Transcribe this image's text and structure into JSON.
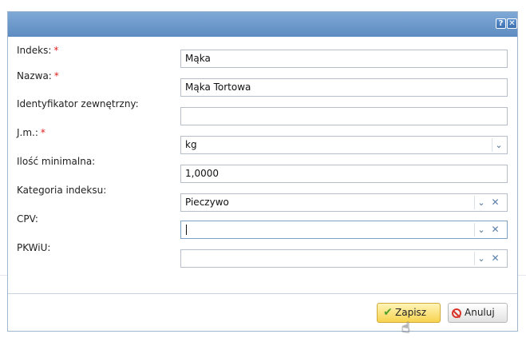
{
  "dialog": {
    "help_glyph": "?",
    "close_glyph": "✕"
  },
  "fields": {
    "index": {
      "label": "Indeks:",
      "required_mark": "*",
      "value": "Mąka"
    },
    "name": {
      "label": "Nazwa:",
      "required_mark": "*",
      "value": "Mąka Tortowa"
    },
    "external_id": {
      "label": "Identyfikator zewnętrzny:",
      "value": ""
    },
    "unit": {
      "label": "J.m.:",
      "required_mark": "*",
      "value": "kg"
    },
    "min_qty": {
      "label": "Ilość minimalna:",
      "value": "1,0000"
    },
    "category": {
      "label": "Kategoria indeksu:",
      "value": "Pieczywo"
    },
    "cpv": {
      "label": "CPV:",
      "value": ""
    },
    "pkwiu": {
      "label": "PKWiU:",
      "value": ""
    }
  },
  "icons": {
    "dropdown": "⌄",
    "clear": "✕",
    "check": "✔",
    "cursor": "☝"
  },
  "buttons": {
    "save_label": "Zapisz",
    "cancel_label": "Anuluj"
  }
}
